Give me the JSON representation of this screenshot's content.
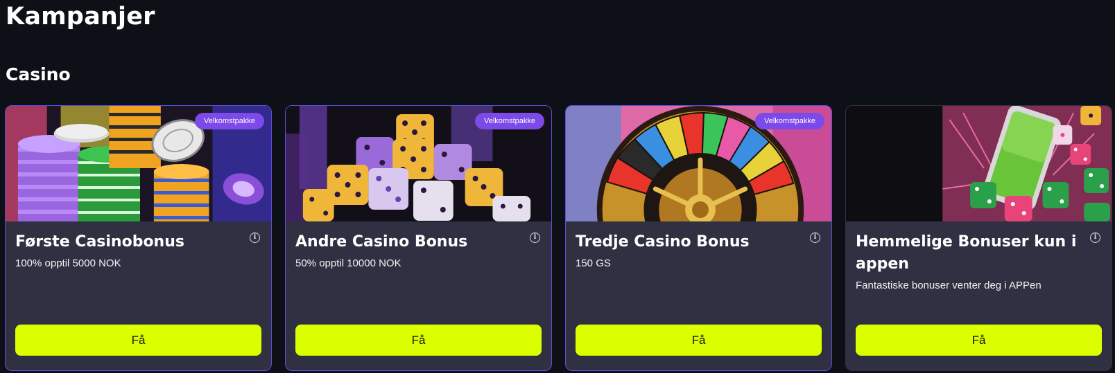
{
  "page": {
    "title": "Kampanjer",
    "section_title": "Casino"
  },
  "colors": {
    "background": "#0d1117",
    "card": "#2f3142",
    "card_border": "#5e4ed8",
    "badge": "#7b4ae8",
    "cta": "#dcff00"
  },
  "cards": [
    {
      "image": "casino-chips-image",
      "badge": "Velkomstpakke",
      "title": "Første Casinobonus",
      "subtitle": "100% opptil 5000 NOK",
      "cta": "Få"
    },
    {
      "image": "dice-image",
      "badge": "Velkomstpakke",
      "title": "Andre Casino Bonus",
      "subtitle": "50% opptil 10000 NOK",
      "cta": "Få"
    },
    {
      "image": "roulette-wheel-image",
      "badge": "Velkomstpakke",
      "title": "Tredje Casino Bonus",
      "subtitle": "150 GS",
      "cta": "Få"
    },
    {
      "image": "phone-dice-image",
      "title": "Hemmelige Bonuser kun i appen",
      "subtitle": "Fantastiske bonuser venter deg i APPen",
      "cta": "Få"
    }
  ]
}
